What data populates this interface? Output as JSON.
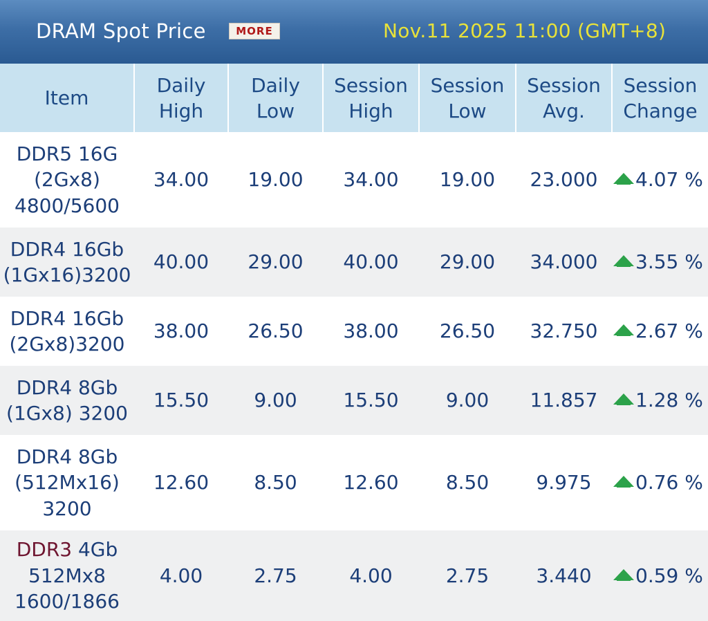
{
  "header": {
    "title": "DRAM Spot Price",
    "more_label": "MORE",
    "datetime": "Nov.11 2025 11:00 (GMT+8)"
  },
  "columns": [
    {
      "line1": "Item",
      "line2": ""
    },
    {
      "line1": "Daily",
      "line2": "High"
    },
    {
      "line1": "Daily",
      "line2": "Low"
    },
    {
      "line1": "Session",
      "line2": "High"
    },
    {
      "line1": "Session",
      "line2": "Low"
    },
    {
      "line1": "Session",
      "line2": "Avg."
    },
    {
      "line1": "Session",
      "line2": "Change"
    }
  ],
  "rows": [
    {
      "item_lines": [
        "DDR5 16G",
        "(2Gx8)",
        "4800/5600"
      ],
      "daily_high": "34.00",
      "daily_low": "19.00",
      "session_high": "34.00",
      "session_low": "19.00",
      "session_avg": "23.000",
      "change": "4.07 %",
      "direction": "up"
    },
    {
      "item_lines": [
        "DDR4 16Gb",
        "(1Gx16)3200"
      ],
      "daily_high": "40.00",
      "daily_low": "29.00",
      "session_high": "40.00",
      "session_low": "29.00",
      "session_avg": "34.000",
      "change": "3.55 %",
      "direction": "up"
    },
    {
      "item_lines": [
        "DDR4 16Gb",
        "(2Gx8)3200"
      ],
      "daily_high": "38.00",
      "daily_low": "26.50",
      "session_high": "38.00",
      "session_low": "26.50",
      "session_avg": "32.750",
      "change": "2.67 %",
      "direction": "up"
    },
    {
      "item_lines": [
        "DDR4 8Gb",
        "(1Gx8) 3200"
      ],
      "daily_high": "15.50",
      "daily_low": "9.00",
      "session_high": "15.50",
      "session_low": "9.00",
      "session_avg": "11.857",
      "change": "1.28 %",
      "direction": "up"
    },
    {
      "item_lines": [
        "DDR4 8Gb",
        "(512Mx16)",
        "3200"
      ],
      "daily_high": "12.60",
      "daily_low": "8.50",
      "session_high": "12.60",
      "session_low": "8.50",
      "session_avg": "9.975",
      "change": "0.76 %",
      "direction": "up"
    },
    {
      "item_prefix": "DDR3",
      "item_lines": [
        " 4Gb",
        "512Mx8",
        "1600/1866"
      ],
      "daily_high": "4.00",
      "daily_low": "2.75",
      "session_high": "4.00",
      "session_low": "2.75",
      "session_avg": "3.440",
      "change": "0.59 %",
      "direction": "up"
    }
  ],
  "colors": {
    "header_bar": "#3d6ea6",
    "column_header_bg": "#c8e2f0",
    "text": "#1c3e78",
    "title_date": "#e8e23a",
    "up_arrow": "#2ca24a",
    "ddr3_label": "#6e1530"
  },
  "icons": {
    "change_direction": "up-arrow-icon"
  }
}
